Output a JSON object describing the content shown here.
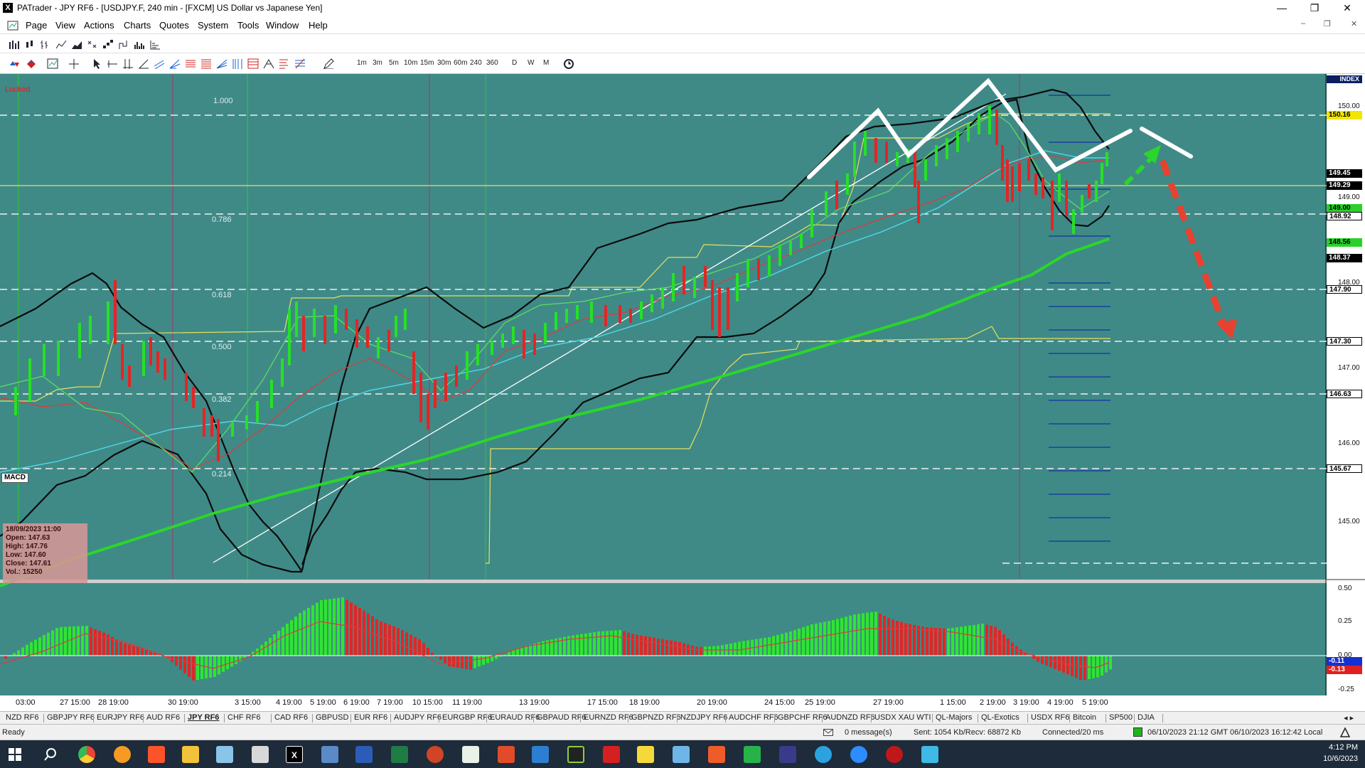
{
  "window": {
    "title": "PATrader - JPY RF6 - [USDJPY.F, 240 min - [FXCM] US Dollar vs Japanese Yen]",
    "icon": "X"
  },
  "menus": [
    "Page",
    "View",
    "Actions",
    "Charts",
    "Quotes",
    "System",
    "Tools",
    "Window",
    "Help"
  ],
  "timeframes": [
    "1m",
    "3m",
    "5m",
    "10m",
    "15m",
    "30m",
    "60m",
    "240",
    "360",
    "D",
    "W",
    "M"
  ],
  "chart": {
    "locked_label": "Locked",
    "index_label": "INDEX",
    "macd_label": "MACD",
    "fib_levels": [
      "1.000",
      "0.786",
      "0.618",
      "0.500",
      "0.382",
      "0.214"
    ],
    "ohlc": {
      "date": "18/09/2023 11:00",
      "open": "Open: 147.63",
      "high": "High: 147.76",
      "low": "Low: 147.60",
      "close": "Close: 147.61",
      "vol": "Vol.: 15250"
    },
    "price_axis": [
      "150.00",
      "149.00",
      "148.00",
      "147.00",
      "146.00",
      "145.00"
    ],
    "price_tags": [
      {
        "label": "150.16",
        "bg": "#f2e600"
      },
      {
        "label": "149.45",
        "bg": "#000000"
      },
      {
        "label": "149.29",
        "bg": "#000000"
      },
      {
        "label": "149.00",
        "bg": "#2ad12a"
      },
      {
        "label": "148.92",
        "bg": "#ffffff"
      },
      {
        "label": "148.56",
        "bg": "#2ad12a"
      },
      {
        "label": "148.37",
        "bg": "#000000"
      },
      {
        "label": "147.90",
        "bg": "#ffffff"
      },
      {
        "label": "147.30",
        "bg": "#ffffff"
      },
      {
        "label": "146.63",
        "bg": "#ffffff"
      },
      {
        "label": "145.67",
        "bg": "#ffffff"
      }
    ],
    "macd_axis": [
      "0.50",
      "0.25",
      "0.00",
      "-0.25"
    ],
    "macd_tags": [
      "-0.11",
      "-0.13"
    ],
    "date_labels": [
      "03:00",
      "27 15:00",
      "28 19:00",
      "30 19:00",
      "3 15:00",
      "4 19:00",
      "5 19:00",
      "6 19:00",
      "7 19:00",
      "10 15:00",
      "11 19:00",
      "13 19:00",
      "17 15:00",
      "18 19:00",
      "20 19:00",
      "24 15:00",
      "25 19:00",
      "27 19:00",
      "1 15:00",
      "2 19:00",
      "3 19:00",
      "4 19:00",
      "5 19:00"
    ]
  },
  "symbol_tabs": [
    "NZD RF6",
    "GBPJPY RF6",
    "EURJPY RF6",
    "AUD RF6",
    "JPY RF6",
    "CHF RF6",
    "CAD RF6",
    "GBPUSD",
    "EUR RF6",
    "AUDJPY RF6",
    "EURGBP RF6",
    "EURAUD RF6",
    "GBPAUD RF6",
    "EURNZD RF6",
    "GBPNZD RF6",
    "NZDJPY RF6",
    "AUDCHF RF6",
    "GBPCHF RF6",
    "AUDNZD RF6",
    "USDX XAU WTI",
    "QL-Majors",
    "QL-Exotics",
    "USDX RF6",
    "Bitcoin",
    "SP500",
    "DJIA"
  ],
  "active_tab": "JPY RF6",
  "status": {
    "ready": "Ready",
    "messages": "0 message(s)",
    "traffic": "Sent: 1054 Kb/Recv: 68872 Kb",
    "connection": "Connected/20 ms",
    "times": "06/10/2023 21:12 GMT  06/10/2023 16:12:42 Local"
  },
  "taskbar": {
    "time": "4:12 PM",
    "date": "10/6/2023"
  }
}
